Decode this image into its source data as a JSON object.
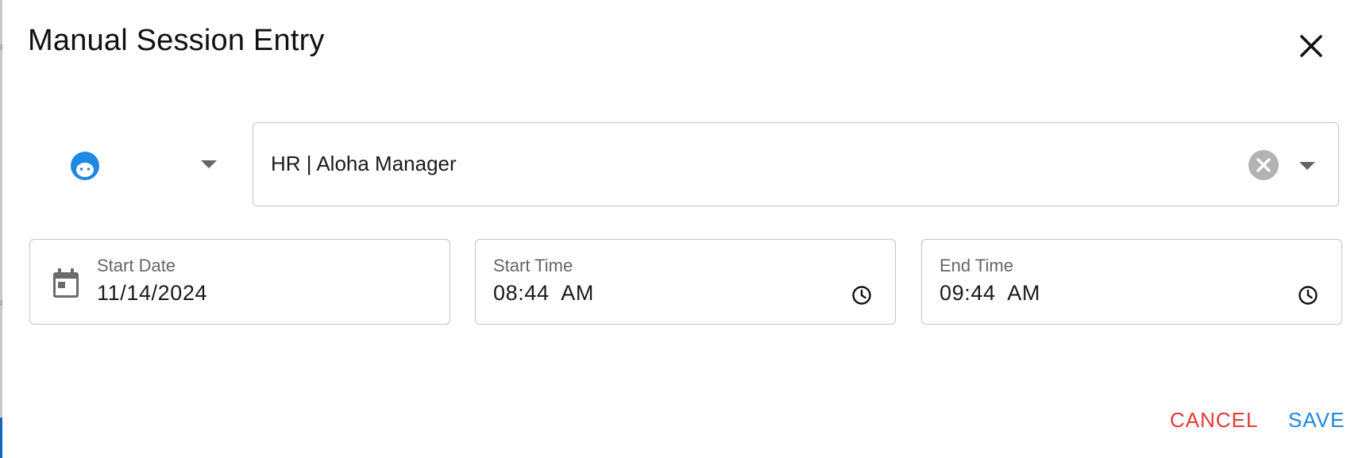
{
  "dialog": {
    "title": "Manual Session Entry",
    "close_icon": "close-icon"
  },
  "session_select": {
    "avatar_icon": "face-icon",
    "avatar_color": "#1e88e5",
    "value": "HR | Aloha Manager"
  },
  "fields": {
    "start_date": {
      "label": "Start Date",
      "value": "11/14/2024",
      "icon": "calendar-icon"
    },
    "start_time": {
      "label": "Start Time",
      "value": "08:44  AM",
      "icon": "clock-icon"
    },
    "end_time": {
      "label": "End Time",
      "value": "09:44  AM",
      "icon": "clock-icon"
    }
  },
  "actions": {
    "cancel_label": "CANCEL",
    "save_label": "SAVE",
    "cancel_color": "#e53935",
    "save_color": "#1e88e5"
  }
}
